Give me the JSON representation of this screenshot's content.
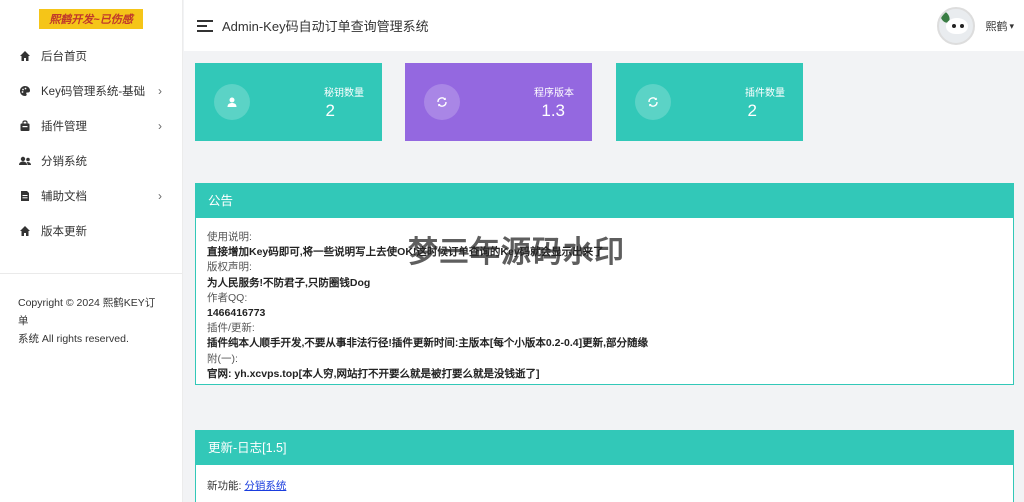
{
  "sidebar": {
    "logo_text": "熙鹤开发~已伤感",
    "items": [
      {
        "label": "后台首页",
        "icon": "home-icon",
        "has_children": false
      },
      {
        "label": "Key码管理系统-基础",
        "icon": "palette-icon",
        "has_children": true
      },
      {
        "label": "插件管理",
        "icon": "bag-icon",
        "has_children": true
      },
      {
        "label": "分销系统",
        "icon": "users-icon",
        "has_children": false
      },
      {
        "label": "辅助文档",
        "icon": "document-icon",
        "has_children": true
      },
      {
        "label": "版本更新",
        "icon": "home-icon",
        "has_children": false
      }
    ],
    "copyright_line1": "Copyright © 2024 熙鹤KEY订单",
    "copyright_line2": "系统 All rights reserved."
  },
  "header": {
    "title": "Admin-Key码自动订单查询管理系统",
    "username": "熙鹤"
  },
  "stats": [
    {
      "label": "秘钥数量",
      "value": "2",
      "icon": "user-icon",
      "color": "#32c8b8"
    },
    {
      "label": "程序版本",
      "value": "1.3",
      "icon": "refresh-icon",
      "color": "#9468e0"
    },
    {
      "label": "插件数量",
      "value": "2",
      "icon": "refresh-icon",
      "color": "#32c8b8"
    }
  ],
  "notice": {
    "title": "公告",
    "lines": [
      "使用说明:",
      "直接增加Key码即可,将一些说明写上去使OK!这时候订单查询的Key码就会显示出来了",
      "版权声明:",
      "为人民服务!不防君子,只防圈钱Dog",
      "作者QQ:",
      "1466416773",
      "插件/更新:",
      "插件纯本人顺手开发,不要从事非法行径!插件更新时间:主版本[每个小版本0.2-0.4]更新,部分随缘",
      "附(一):",
      "官网: yh.xcvps.top[本人穷,网站打不开要么就是被打要么就是没钱逝了]"
    ]
  },
  "changelog": {
    "title": "更新-日志[1.5]",
    "label": "新功能:",
    "link_text": "分销系统"
  },
  "watermark": "梦三年源码水印",
  "colors": {
    "accent": "#32c8b8",
    "purple": "#9468e0"
  }
}
